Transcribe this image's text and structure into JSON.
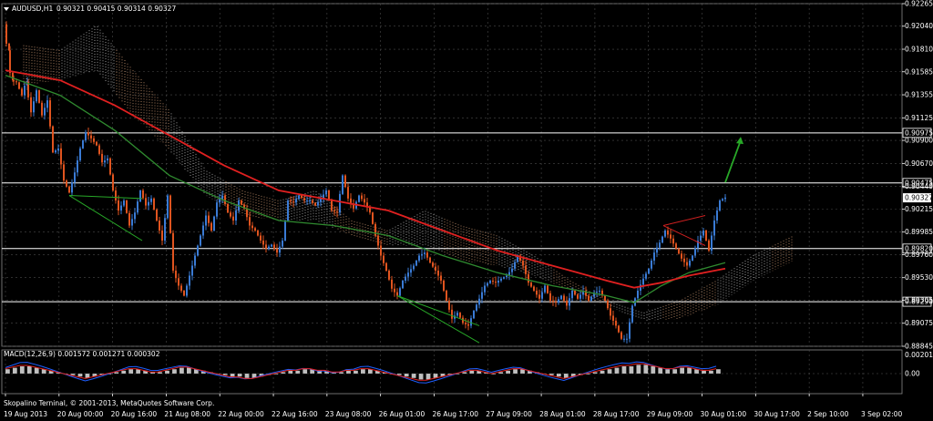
{
  "header": {
    "symbol": "AUDUSD,H1",
    "ohlc": "0.90321 0.90415 0.90314 0.90327"
  },
  "macd": {
    "label": "MACD(12,26,9) 0.001572 0.001271 0.000302"
  },
  "footer": {
    "copyright": "Skopalino Terninal, © 2001-2013, MetaQuotes Software Corp."
  },
  "colors": {
    "background": "#000000",
    "grid": "#4a4a4a",
    "bull": "#3a7bd5",
    "bear": "#e0541f",
    "ma_fast": "#2f8a2f",
    "ma_slow": "#e02020",
    "cloud_top": "#d9a27a",
    "cloud_bottom": "#c8c8c8",
    "macd_main": "#1e5fff",
    "macd_signal": "#e02020",
    "arrow": "#28a828"
  },
  "chart_data": {
    "type": "candlestick",
    "title": "",
    "xlabel": "",
    "ylabel": "",
    "ylim": [
      0.88845,
      0.92265
    ],
    "grid": true,
    "price_ticks": [
      "0.92265",
      "0.92040",
      "0.91810",
      "0.91585",
      "0.91355",
      "0.91125",
      "0.90900",
      "0.90670",
      "0.90440",
      "0.90215",
      "0.89985",
      "0.89760",
      "0.89530",
      "0.89305",
      "0.89075",
      "0.88845"
    ],
    "time_labels": [
      "19 Aug 2013",
      "20 Aug 00:00",
      "20 Aug 16:00",
      "21 Aug 08:00",
      "22 Aug 00:00",
      "22 Aug 16:00",
      "23 Aug 08:00",
      "26 Aug 01:00",
      "26 Aug 17:00",
      "27 Aug 09:00",
      "28 Aug 01:00",
      "28 Aug 17:00",
      "29 Aug 09:00",
      "30 Aug 01:00",
      "30 Aug 17:00",
      "2 Sep 10:00",
      "3 Sep 02:00"
    ],
    "horizontal_levels": [
      {
        "label": "0.90975",
        "value": 0.90975
      },
      {
        "label": "0.90475",
        "value": 0.90475
      },
      {
        "label": "0.89820",
        "value": 0.8982
      },
      {
        "label": "0.89290",
        "value": 0.8929
      }
    ],
    "current_price": "0.90327",
    "path": [
      [
        0,
        0.9206
      ],
      [
        4,
        0.918
      ],
      [
        8,
        0.915
      ],
      [
        14,
        0.9148
      ],
      [
        20,
        0.9135
      ],
      [
        24,
        0.9148
      ],
      [
        30,
        0.9118
      ],
      [
        36,
        0.914
      ],
      [
        42,
        0.9115
      ],
      [
        48,
        0.913
      ],
      [
        54,
        0.9078
      ],
      [
        60,
        0.9082
      ],
      [
        66,
        0.905
      ],
      [
        72,
        0.9038
      ],
      [
        78,
        0.9058
      ],
      [
        84,
        0.9082
      ],
      [
        90,
        0.9098
      ],
      [
        96,
        0.9092
      ],
      [
        102,
        0.9085
      ],
      [
        108,
        0.9068
      ],
      [
        114,
        0.9072
      ],
      [
        120,
        0.904
      ],
      [
        126,
        0.902
      ],
      [
        132,
        0.903
      ],
      [
        138,
        0.9005
      ],
      [
        144,
        0.9018
      ],
      [
        150,
        0.904
      ],
      [
        156,
        0.9025
      ],
      [
        162,
        0.9032
      ],
      [
        168,
        0.901
      ],
      [
        174,
        0.899
      ],
      [
        180,
        0.9035
      ],
      [
        186,
        0.896
      ],
      [
        192,
        0.8945
      ],
      [
        198,
        0.8935
      ],
      [
        204,
        0.8955
      ],
      [
        210,
        0.8975
      ],
      [
        216,
        0.8995
      ],
      [
        222,
        0.9015
      ],
      [
        228,
        0.9
      ],
      [
        234,
        0.9028
      ],
      [
        240,
        0.9035
      ],
      [
        246,
        0.9018
      ],
      [
        252,
        0.901
      ],
      [
        258,
        0.903
      ],
      [
        264,
        0.9022
      ],
      [
        270,
        0.9005
      ],
      [
        276,
        0.9
      ],
      [
        282,
        0.899
      ],
      [
        288,
        0.8982
      ],
      [
        294,
        0.8986
      ],
      [
        300,
        0.8978
      ],
      [
        306,
        0.899
      ],
      [
        312,
        0.903
      ],
      [
        318,
        0.9028
      ],
      [
        324,
        0.9035
      ],
      [
        330,
        0.903
      ],
      [
        336,
        0.903
      ],
      [
        342,
        0.9025
      ],
      [
        348,
        0.9032
      ],
      [
        354,
        0.904
      ],
      [
        360,
        0.902
      ],
      [
        366,
        0.9018
      ],
      [
        372,
        0.9055
      ],
      [
        378,
        0.9032
      ],
      [
        384,
        0.9022
      ],
      [
        390,
        0.9035
      ],
      [
        396,
        0.9028
      ],
      [
        402,
        0.9018
      ],
      [
        408,
        0.8995
      ],
      [
        414,
        0.8975
      ],
      [
        420,
        0.896
      ],
      [
        426,
        0.8942
      ],
      [
        432,
        0.8935
      ],
      [
        438,
        0.895
      ],
      [
        444,
        0.8958
      ],
      [
        450,
        0.8965
      ],
      [
        456,
        0.8975
      ],
      [
        462,
        0.8978
      ],
      [
        468,
        0.8968
      ],
      [
        474,
        0.896
      ],
      [
        480,
        0.895
      ],
      [
        486,
        0.893
      ],
      [
        492,
        0.8912
      ],
      [
        498,
        0.8918
      ],
      [
        504,
        0.8908
      ],
      [
        510,
        0.8905
      ],
      [
        516,
        0.892
      ],
      [
        522,
        0.8932
      ],
      [
        528,
        0.8945
      ],
      [
        534,
        0.895
      ],
      [
        540,
        0.8948
      ],
      [
        546,
        0.8952
      ],
      [
        552,
        0.8955
      ],
      [
        558,
        0.8962
      ],
      [
        564,
        0.8975
      ],
      [
        570,
        0.8965
      ],
      [
        576,
        0.8948
      ],
      [
        582,
        0.894
      ],
      [
        588,
        0.8932
      ],
      [
        594,
        0.8945
      ],
      [
        600,
        0.893
      ],
      [
        606,
        0.8928
      ],
      [
        612,
        0.8935
      ],
      [
        618,
        0.8925
      ],
      [
        624,
        0.894
      ],
      [
        630,
        0.8932
      ],
      [
        636,
        0.894
      ],
      [
        642,
        0.893
      ],
      [
        648,
        0.8938
      ],
      [
        654,
        0.894
      ],
      [
        660,
        0.893
      ],
      [
        666,
        0.8915
      ],
      [
        672,
        0.8905
      ],
      [
        678,
        0.8892
      ],
      [
        684,
        0.8892
      ],
      [
        690,
        0.8925
      ],
      [
        696,
        0.894
      ],
      [
        702,
        0.8952
      ],
      [
        708,
        0.8962
      ],
      [
        714,
        0.8978
      ],
      [
        720,
        0.8988
      ],
      [
        726,
        0.9
      ],
      [
        732,
        0.8992
      ],
      [
        738,
        0.8982
      ],
      [
        744,
        0.8972
      ],
      [
        750,
        0.8965
      ],
      [
        756,
        0.8975
      ],
      [
        762,
        0.899
      ],
      [
        768,
        0.9
      ],
      [
        774,
        0.898
      ],
      [
        780,
        0.901
      ],
      [
        786,
        0.903
      ],
      [
        792,
        0.9033
      ]
    ],
    "ma_slow": [
      [
        0,
        0.916
      ],
      [
        60,
        0.915
      ],
      [
        120,
        0.9125
      ],
      [
        180,
        0.9095
      ],
      [
        240,
        0.9065
      ],
      [
        300,
        0.904
      ],
      [
        360,
        0.903
      ],
      [
        420,
        0.902
      ],
      [
        480,
        0.9
      ],
      [
        540,
        0.898
      ],
      [
        600,
        0.8965
      ],
      [
        660,
        0.895
      ],
      [
        690,
        0.8943
      ],
      [
        720,
        0.8948
      ],
      [
        750,
        0.8955
      ],
      [
        790,
        0.8962
      ]
    ],
    "ma_fast": [
      [
        0,
        0.9155
      ],
      [
        60,
        0.9135
      ],
      [
        120,
        0.91
      ],
      [
        180,
        0.9055
      ],
      [
        240,
        0.903
      ],
      [
        300,
        0.901
      ],
      [
        360,
        0.9005
      ],
      [
        420,
        0.8995
      ],
      [
        480,
        0.8975
      ],
      [
        540,
        0.8958
      ],
      [
        600,
        0.8945
      ],
      [
        660,
        0.8935
      ],
      [
        690,
        0.8928
      ],
      [
        720,
        0.8945
      ],
      [
        750,
        0.8958
      ],
      [
        790,
        0.8968
      ]
    ],
    "cloud_top": [
      [
        20,
        0.9185
      ],
      [
        60,
        0.918
      ],
      [
        100,
        0.9205
      ],
      [
        140,
        0.916
      ],
      [
        180,
        0.912
      ],
      [
        220,
        0.906
      ],
      [
        260,
        0.904
      ],
      [
        300,
        0.903
      ],
      [
        340,
        0.904
      ],
      [
        380,
        0.901
      ],
      [
        420,
        0.9
      ],
      [
        460,
        0.902
      ],
      [
        500,
        0.9005
      ],
      [
        540,
        0.8995
      ],
      [
        580,
        0.8975
      ],
      [
        620,
        0.895
      ],
      [
        660,
        0.893
      ],
      [
        700,
        0.8918
      ],
      [
        740,
        0.893
      ],
      [
        780,
        0.895
      ],
      [
        820,
        0.8975
      ],
      [
        865,
        0.8995
      ]
    ],
    "cloud_bottom": [
      [
        20,
        0.9145
      ],
      [
        60,
        0.915
      ],
      [
        100,
        0.916
      ],
      [
        140,
        0.9115
      ],
      [
        180,
        0.908
      ],
      [
        220,
        0.9035
      ],
      [
        260,
        0.9015
      ],
      [
        300,
        0.901
      ],
      [
        340,
        0.901
      ],
      [
        380,
        0.8995
      ],
      [
        420,
        0.8985
      ],
      [
        460,
        0.8985
      ],
      [
        500,
        0.897
      ],
      [
        540,
        0.8965
      ],
      [
        580,
        0.8955
      ],
      [
        620,
        0.894
      ],
      [
        660,
        0.8925
      ],
      [
        700,
        0.891
      ],
      [
        740,
        0.8912
      ],
      [
        780,
        0.8925
      ],
      [
        820,
        0.895
      ],
      [
        865,
        0.897
      ]
    ],
    "macd_hist": [
      3,
      4,
      5,
      5,
      4,
      3,
      2,
      1,
      0,
      -1,
      -2,
      -3,
      -2,
      -1,
      0,
      1,
      2,
      3,
      3,
      2,
      1,
      1,
      2,
      3,
      4,
      4,
      3,
      2,
      1,
      0,
      -1,
      -2,
      -2,
      -3,
      -3,
      -2,
      -1,
      0,
      1,
      2,
      2,
      3,
      3,
      2,
      2,
      1,
      1,
      2,
      2,
      3,
      3,
      2,
      1,
      0,
      -1,
      -2,
      -3,
      -4,
      -4,
      -3,
      -2,
      -1,
      0,
      1,
      2,
      2,
      1,
      0,
      1,
      2,
      3,
      3,
      2,
      1,
      0,
      -1,
      -2,
      -3,
      -2,
      -1,
      0,
      1,
      2,
      3,
      4,
      5,
      5,
      6,
      6,
      5,
      4,
      3,
      3,
      4,
      4,
      3,
      2,
      2,
      3
    ]
  }
}
